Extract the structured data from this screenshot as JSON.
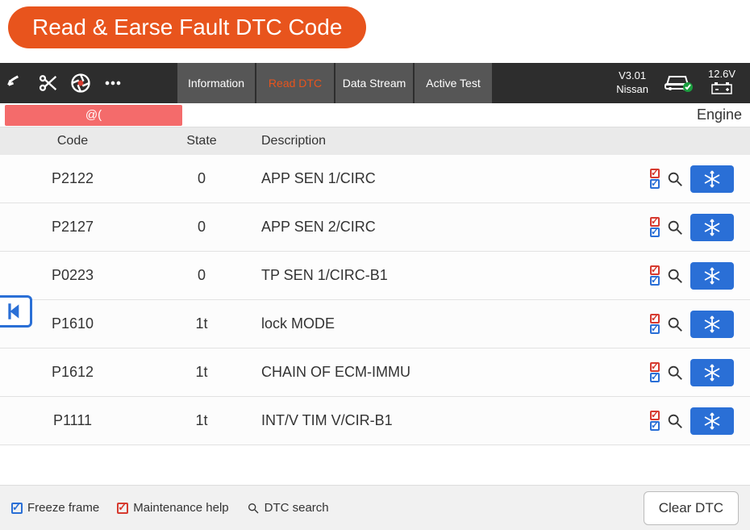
{
  "title": "Read & Earse Fault DTC Code",
  "toolbar": {
    "tabs": [
      {
        "label": "Information"
      },
      {
        "label": "Read DTC",
        "active": true
      },
      {
        "label": "Data Stream"
      },
      {
        "label": "Active Test"
      }
    ],
    "version": "V3.01",
    "vehicle": "Nissan",
    "voltage": "12.6V"
  },
  "breadcrumb": {
    "path": "@(",
    "context": "Engine"
  },
  "headers": {
    "code": "Code",
    "state": "State",
    "desc": "Description"
  },
  "rows": [
    {
      "code": "P2122",
      "state": "0",
      "desc": "APP SEN 1/CIRC"
    },
    {
      "code": "P2127",
      "state": "0",
      "desc": "APP SEN 2/CIRC"
    },
    {
      "code": "P0223",
      "state": "0",
      "desc": "TP SEN 1/CIRC-B1"
    },
    {
      "code": "P1610",
      "state": "1t",
      "desc": "lock MODE"
    },
    {
      "code": "P1612",
      "state": "1t",
      "desc": "CHAIN OF ECM-IMMU"
    },
    {
      "code": "P1111",
      "state": "1t",
      "desc": "INT/V TIM V/CIR-B1"
    }
  ],
  "footer": {
    "freeze": "Freeze frame",
    "maint": "Maintenance help",
    "search": "DTC search",
    "clear": "Clear DTC"
  }
}
